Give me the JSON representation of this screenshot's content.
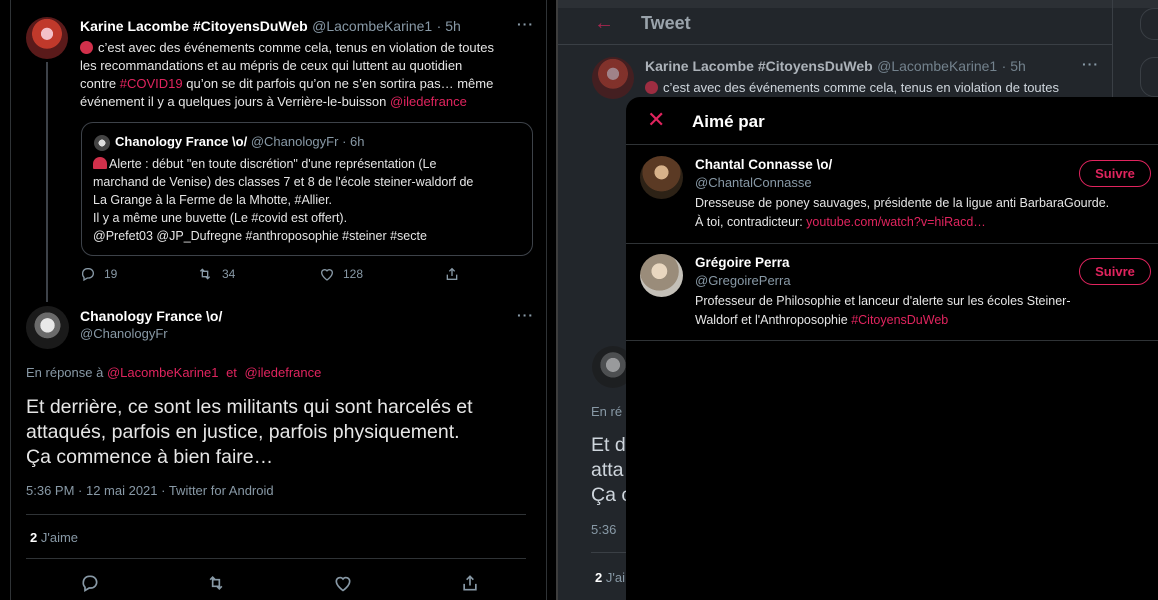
{
  "left": {
    "tweet1": {
      "name": "Karine Lacombe #CitoyensDuWeb",
      "handle": "@LacombeKarine1",
      "time": "· 5h",
      "line1": "c’est avec des événements comme cela, tenus en violation de toutes",
      "line2": "les recommandations et au mépris de ceux qui luttent au quotidien",
      "line3_a": "contre ",
      "line3_hashtag": "#COVID19",
      "line3_b": " qu’on se dit parfois qu’on ne s’en sortira pas… même",
      "line4_a": "événement il y a quelques jours à Verrière-le-buisson ",
      "line4_mention": "@iledefrance",
      "quote": {
        "name": "Chanology France \\o/",
        "handle": "@ChanologyFr",
        "time": "· 6h",
        "line1": "Alerte : début \"en toute discrétion\" d'une représentation (Le",
        "line2": "marchand de Venise) des classes 7 et 8 de l'école steiner-waldorf de",
        "line3": "La Grange à la Ferme de la Mhotte, #Allier.",
        "line4": "Il y a même une buvette (Le #covid est offert).",
        "line5": "@Prefet03 @JP_Dufregne #anthroposophie #steiner #secte"
      },
      "replies": "19",
      "retweets": "34",
      "likes": "128"
    },
    "tweet2": {
      "name": "Chanology France \\o/",
      "handle": "@ChanologyFr",
      "reply_prefix": "En réponse à",
      "reply_to_1": "@LacombeKarine1",
      "reply_and": "et",
      "reply_to_2": "@iledefrance",
      "line1": "Et derrière, ce sont les militants qui sont harcelés et",
      "line2": "attaqués, parfois en justice, parfois physiquement.",
      "line3": "Ça commence à bien faire…",
      "meta": "5:36 PM · 12 mai 2021 · Twitter for Android",
      "likes_count": "2",
      "likes_label": "J'aime"
    }
  },
  "right": {
    "header_title": "Tweet",
    "tweet": {
      "name": "Karine Lacombe #CitoyensDuWeb",
      "handle": "@LacombeKarine1",
      "time": "· 5h",
      "line1": "c’est avec des événements comme cela, tenus en violation de toutes"
    },
    "behind": {
      "reply_frag": "En ré",
      "text1": "Et d",
      "text2": "atta",
      "text3": "Ça c",
      "meta": "5:36",
      "likes_count": "2",
      "likes_frag": "J'ai"
    },
    "modal": {
      "title": "Aimé par",
      "users": [
        {
          "name": "Chantal Connasse \\o/",
          "handle": "@ChantalConnasse",
          "follow": "Suivre",
          "bio1": "Dresseuse de poney sauvages, présidente de la ligue anti BarbaraGourde.",
          "bio2_a": "À toi, contradicteur: ",
          "bio2_link": "youtube.com/watch?v=hiRacd…"
        },
        {
          "name": "Grégoire Perra",
          "handle": "@GregoirePerra",
          "follow": "Suivre",
          "bio1": "Professeur de Philosophie et lanceur d'alerte sur les écoles Steiner-",
          "bio2_a": "Waldorf et l'Anthroposophie ",
          "bio2_link": "#CitoyensDuWeb"
        }
      ]
    }
  },
  "colors": {
    "accent": "#e0245e",
    "muted": "#8899a6",
    "bg_dark": "#000000",
    "bg_dim": "#22262b"
  },
  "icons": [
    "reply-icon",
    "retweet-icon",
    "like-icon",
    "share-icon",
    "more-icon",
    "back-arrow-icon",
    "close-icon"
  ]
}
